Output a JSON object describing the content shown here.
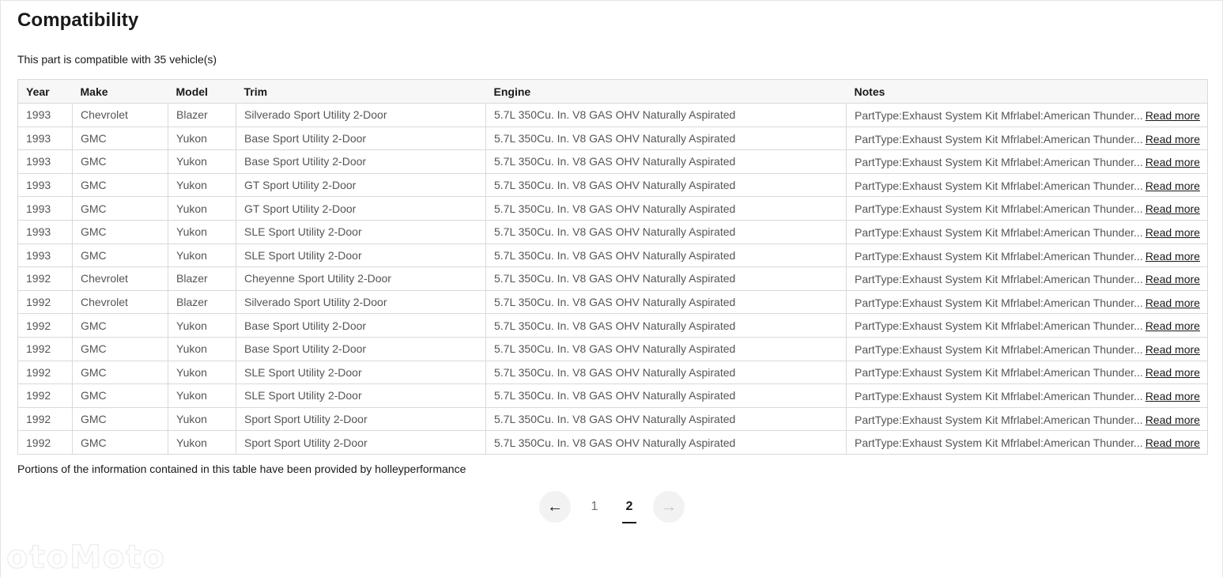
{
  "title": "Compatibility",
  "subtitle": "This part is compatible with 35 vehicle(s)",
  "table": {
    "headers": [
      "Year",
      "Make",
      "Model",
      "Trim",
      "Engine",
      "Notes"
    ],
    "read_more_label": "Read more",
    "rows": [
      {
        "year": "1993",
        "make": "Chevrolet",
        "model": "Blazer",
        "trim": "Silverado Sport Utility 2-Door",
        "engine": "5.7L 350Cu. In. V8 GAS OHV Naturally Aspirated",
        "notes": "PartType:Exhaust System Kit Mfrlabel:American Thunder..."
      },
      {
        "year": "1993",
        "make": "GMC",
        "model": "Yukon",
        "trim": "Base Sport Utility 2-Door",
        "engine": "5.7L 350Cu. In. V8 GAS OHV Naturally Aspirated",
        "notes": "PartType:Exhaust System Kit Mfrlabel:American Thunder..."
      },
      {
        "year": "1993",
        "make": "GMC",
        "model": "Yukon",
        "trim": "Base Sport Utility 2-Door",
        "engine": "5.7L 350Cu. In. V8 GAS OHV Naturally Aspirated",
        "notes": "PartType:Exhaust System Kit Mfrlabel:American Thunder..."
      },
      {
        "year": "1993",
        "make": "GMC",
        "model": "Yukon",
        "trim": "GT Sport Utility 2-Door",
        "engine": "5.7L 350Cu. In. V8 GAS OHV Naturally Aspirated",
        "notes": "PartType:Exhaust System Kit Mfrlabel:American Thunder..."
      },
      {
        "year": "1993",
        "make": "GMC",
        "model": "Yukon",
        "trim": "GT Sport Utility 2-Door",
        "engine": "5.7L 350Cu. In. V8 GAS OHV Naturally Aspirated",
        "notes": "PartType:Exhaust System Kit Mfrlabel:American Thunder..."
      },
      {
        "year": "1993",
        "make": "GMC",
        "model": "Yukon",
        "trim": "SLE Sport Utility 2-Door",
        "engine": "5.7L 350Cu. In. V8 GAS OHV Naturally Aspirated",
        "notes": "PartType:Exhaust System Kit Mfrlabel:American Thunder..."
      },
      {
        "year": "1993",
        "make": "GMC",
        "model": "Yukon",
        "trim": "SLE Sport Utility 2-Door",
        "engine": "5.7L 350Cu. In. V8 GAS OHV Naturally Aspirated",
        "notes": "PartType:Exhaust System Kit Mfrlabel:American Thunder..."
      },
      {
        "year": "1992",
        "make": "Chevrolet",
        "model": "Blazer",
        "trim": "Cheyenne Sport Utility 2-Door",
        "engine": "5.7L 350Cu. In. V8 GAS OHV Naturally Aspirated",
        "notes": "PartType:Exhaust System Kit Mfrlabel:American Thunder..."
      },
      {
        "year": "1992",
        "make": "Chevrolet",
        "model": "Blazer",
        "trim": "Silverado Sport Utility 2-Door",
        "engine": "5.7L 350Cu. In. V8 GAS OHV Naturally Aspirated",
        "notes": "PartType:Exhaust System Kit Mfrlabel:American Thunder..."
      },
      {
        "year": "1992",
        "make": "GMC",
        "model": "Yukon",
        "trim": "Base Sport Utility 2-Door",
        "engine": "5.7L 350Cu. In. V8 GAS OHV Naturally Aspirated",
        "notes": "PartType:Exhaust System Kit Mfrlabel:American Thunder..."
      },
      {
        "year": "1992",
        "make": "GMC",
        "model": "Yukon",
        "trim": "Base Sport Utility 2-Door",
        "engine": "5.7L 350Cu. In. V8 GAS OHV Naturally Aspirated",
        "notes": "PartType:Exhaust System Kit Mfrlabel:American Thunder..."
      },
      {
        "year": "1992",
        "make": "GMC",
        "model": "Yukon",
        "trim": "SLE Sport Utility 2-Door",
        "engine": "5.7L 350Cu. In. V8 GAS OHV Naturally Aspirated",
        "notes": "PartType:Exhaust System Kit Mfrlabel:American Thunder..."
      },
      {
        "year": "1992",
        "make": "GMC",
        "model": "Yukon",
        "trim": "SLE Sport Utility 2-Door",
        "engine": "5.7L 350Cu. In. V8 GAS OHV Naturally Aspirated",
        "notes": "PartType:Exhaust System Kit Mfrlabel:American Thunder..."
      },
      {
        "year": "1992",
        "make": "GMC",
        "model": "Yukon",
        "trim": "Sport Sport Utility 2-Door",
        "engine": "5.7L 350Cu. In. V8 GAS OHV Naturally Aspirated",
        "notes": "PartType:Exhaust System Kit Mfrlabel:American Thunder..."
      },
      {
        "year": "1992",
        "make": "GMC",
        "model": "Yukon",
        "trim": "Sport Sport Utility 2-Door",
        "engine": "5.7L 350Cu. In. V8 GAS OHV Naturally Aspirated",
        "notes": "PartType:Exhaust System Kit Mfrlabel:American Thunder..."
      }
    ]
  },
  "footnote": "Portions of the information contained in this table have been provided by holleyperformance",
  "pagination": {
    "prev_icon": "arrow-left-icon",
    "next_icon": "arrow-right-icon",
    "pages": [
      "1",
      "2"
    ],
    "current": "2"
  },
  "watermark": "otoMoto"
}
